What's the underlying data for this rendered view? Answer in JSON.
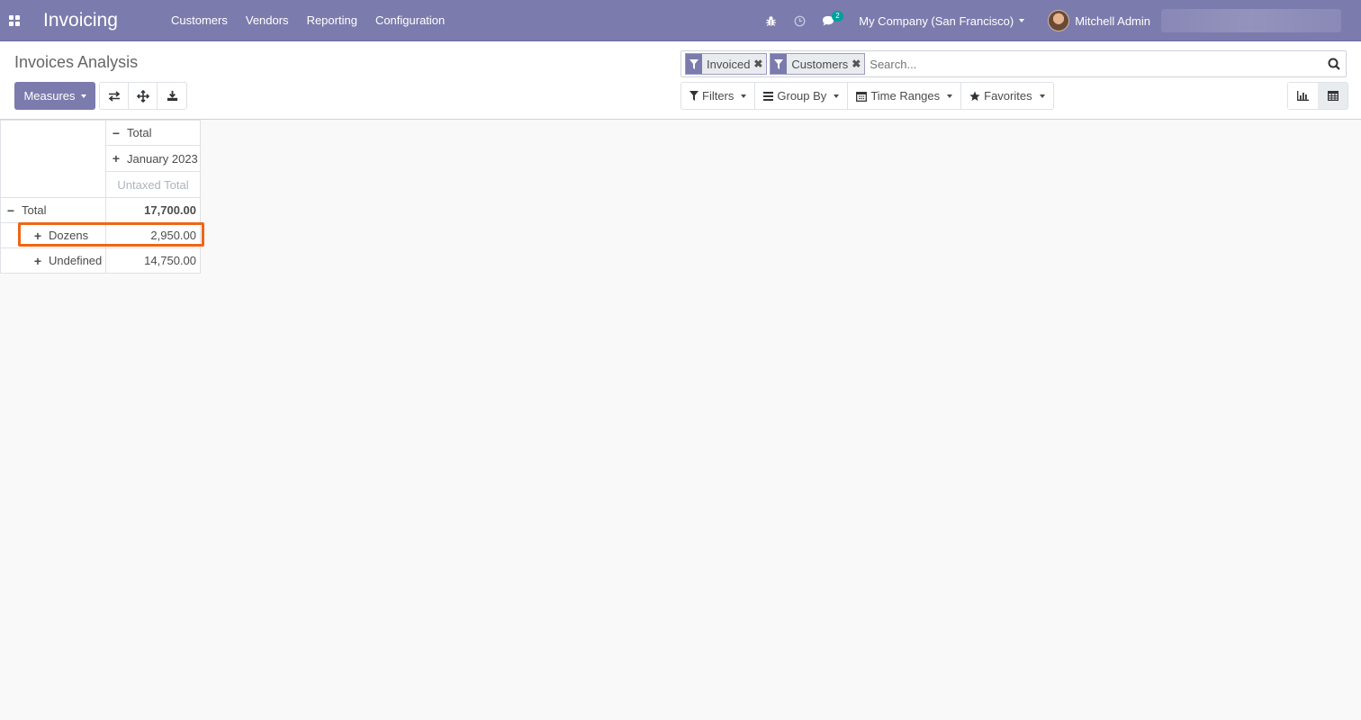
{
  "app": {
    "title": "Invoicing",
    "menu": [
      "Customers",
      "Vendors",
      "Reporting",
      "Configuration"
    ]
  },
  "systray": {
    "messages_count": "2",
    "company": "My Company (San Francisco)",
    "user": "Mitchell Admin"
  },
  "control_panel": {
    "breadcrumb": "Invoices Analysis",
    "measures_label": "Measures",
    "facets": [
      {
        "label": "Invoiced",
        "icon": "filter-icon"
      },
      {
        "label": "Customers",
        "icon": "filter-icon"
      }
    ],
    "search_placeholder": "Search...",
    "filters_label": "Filters",
    "groupby_label": "Group By",
    "timeranges_label": "Time Ranges",
    "favorites_label": "Favorites"
  },
  "pivot": {
    "col_header_total": "Total",
    "col_header_period": "January 2023",
    "measure_header": "Untaxed Total",
    "rows": [
      {
        "label": "Total",
        "value": "17,700.00",
        "expanded": true
      },
      {
        "label": "Dozens",
        "value": "2,950.00",
        "expanded": false
      },
      {
        "label": "Undefined",
        "value": "14,750.00",
        "expanded": false
      }
    ]
  },
  "colors": {
    "brand": "#7c7bad",
    "highlight": "#f06516",
    "badge": "#00a09d"
  }
}
